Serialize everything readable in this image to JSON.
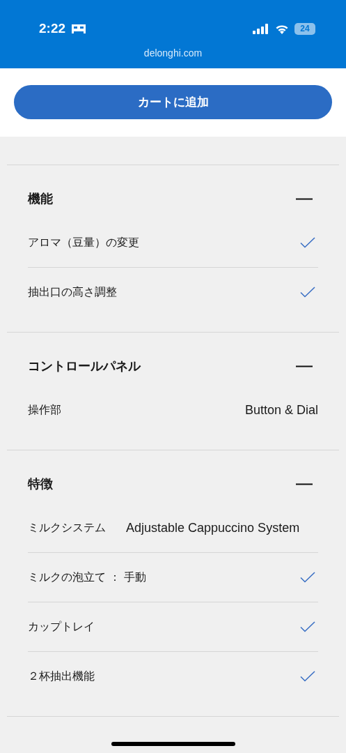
{
  "status_bar": {
    "time": "2:22",
    "battery": "24"
  },
  "address_bar": {
    "url": "delonghi.com"
  },
  "add_to_cart_button": {
    "label": "カートに追加"
  },
  "sections": [
    {
      "title": "機能",
      "expanded": true,
      "rows": [
        {
          "kind": "check",
          "label": "アロマ（豆量）の変更"
        },
        {
          "kind": "check",
          "label": "抽出口の高さ調整"
        }
      ]
    },
    {
      "title": "コントロールパネル",
      "expanded": true,
      "rows": [
        {
          "kind": "value",
          "label": "操作部",
          "value": "Button & Dial"
        }
      ]
    },
    {
      "title": "特徴",
      "expanded": true,
      "rows": [
        {
          "kind": "value",
          "label": "ミルクシステム",
          "value": "Adjustable Cappuccino System"
        },
        {
          "kind": "check",
          "label": "ミルクの泡立て ： 手動"
        },
        {
          "kind": "check",
          "label": "カップトレイ"
        },
        {
          "kind": "check",
          "label": "２杯抽出機能"
        }
      ]
    }
  ]
}
